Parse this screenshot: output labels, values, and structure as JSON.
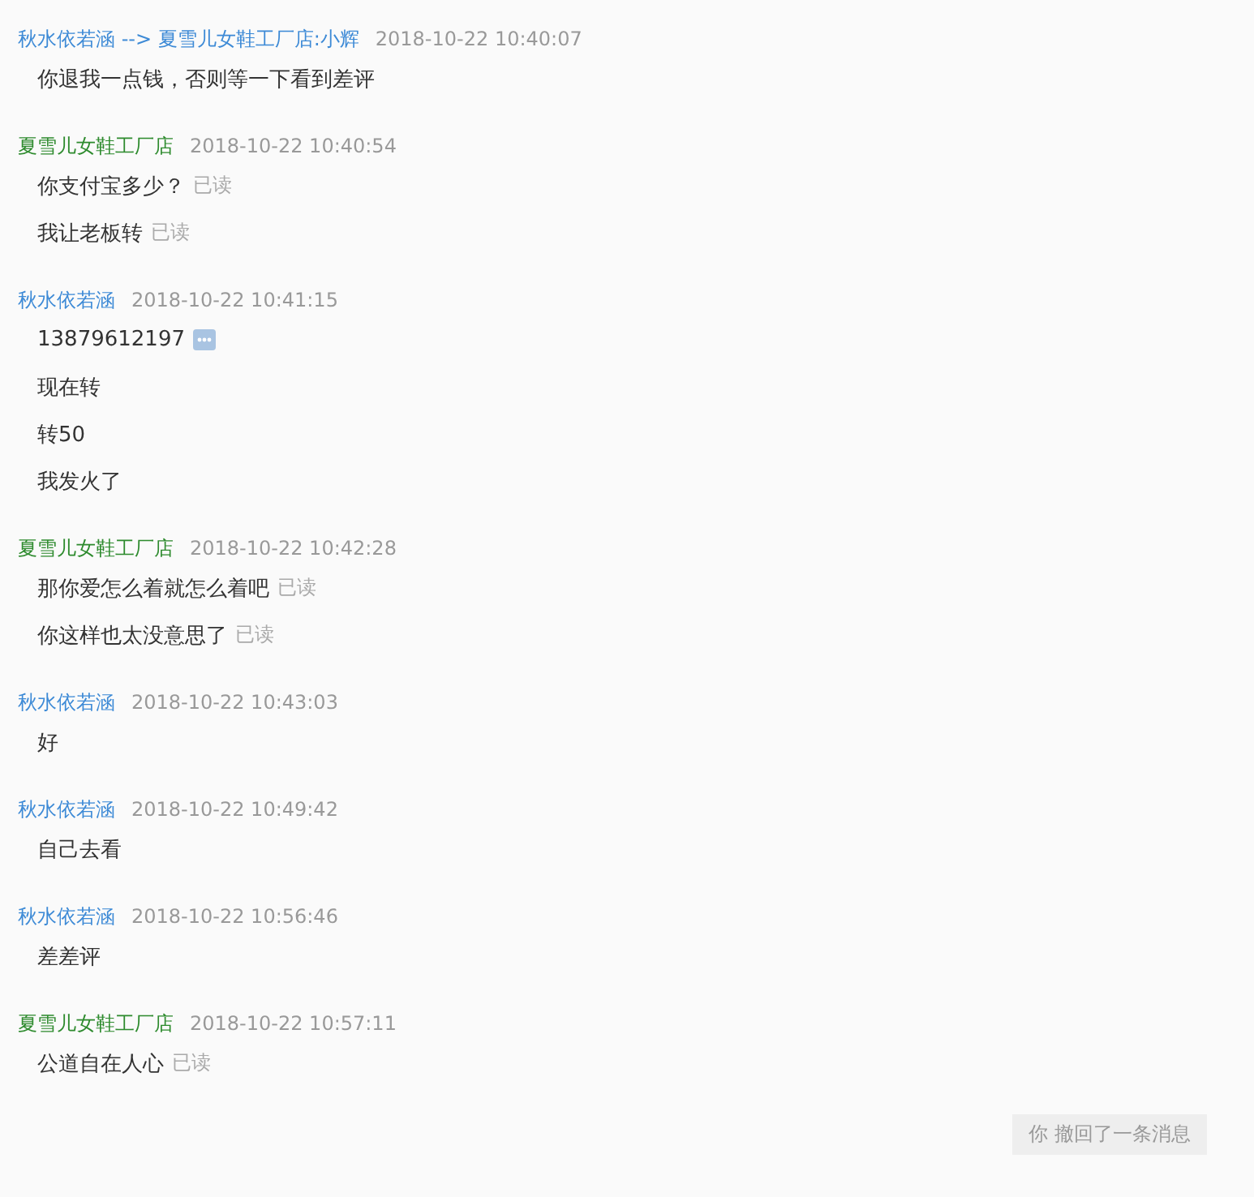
{
  "groups": [
    {
      "sender": "秋水依若涵 --> 夏雪儿女鞋工厂店:小辉",
      "kind": "buyer",
      "time": "2018-10-22 10:40:07",
      "messages": [
        {
          "text": "你退我一点钱，否则等一下看到差评"
        }
      ]
    },
    {
      "sender": "夏雪儿女鞋工厂店",
      "kind": "seller",
      "time": "2018-10-22 10:40:54",
      "messages": [
        {
          "text": "你支付宝多少？",
          "status": "已读"
        },
        {
          "text": "我让老板转",
          "status": "已读"
        }
      ]
    },
    {
      "sender": "秋水依若涵",
      "kind": "buyer",
      "time": "2018-10-22 10:41:15",
      "messages": [
        {
          "text": "13879612197",
          "more_icon": true
        },
        {
          "text": "现在转"
        },
        {
          "text": "转50"
        },
        {
          "text": "我发火了"
        }
      ]
    },
    {
      "sender": "夏雪儿女鞋工厂店",
      "kind": "seller",
      "time": "2018-10-22 10:42:28",
      "messages": [
        {
          "text": "那你爱怎么着就怎么着吧",
          "status": "已读"
        },
        {
          "text": "你这样也太没意思了",
          "status": "已读"
        }
      ]
    },
    {
      "sender": "秋水依若涵",
      "kind": "buyer",
      "time": "2018-10-22 10:43:03",
      "messages": [
        {
          "text": "好"
        }
      ]
    },
    {
      "sender": "秋水依若涵",
      "kind": "buyer",
      "time": "2018-10-22 10:49:42",
      "messages": [
        {
          "text": "自己去看"
        }
      ]
    },
    {
      "sender": "秋水依若涵",
      "kind": "buyer",
      "time": "2018-10-22 10:56:46",
      "messages": [
        {
          "text": "差差评"
        }
      ]
    },
    {
      "sender": "夏雪儿女鞋工厂店",
      "kind": "seller",
      "time": "2018-10-22 10:57:11",
      "messages": [
        {
          "text": "公道自在人心",
          "status": "已读"
        }
      ]
    }
  ],
  "recall_notice": "你 撤回了一条消息"
}
